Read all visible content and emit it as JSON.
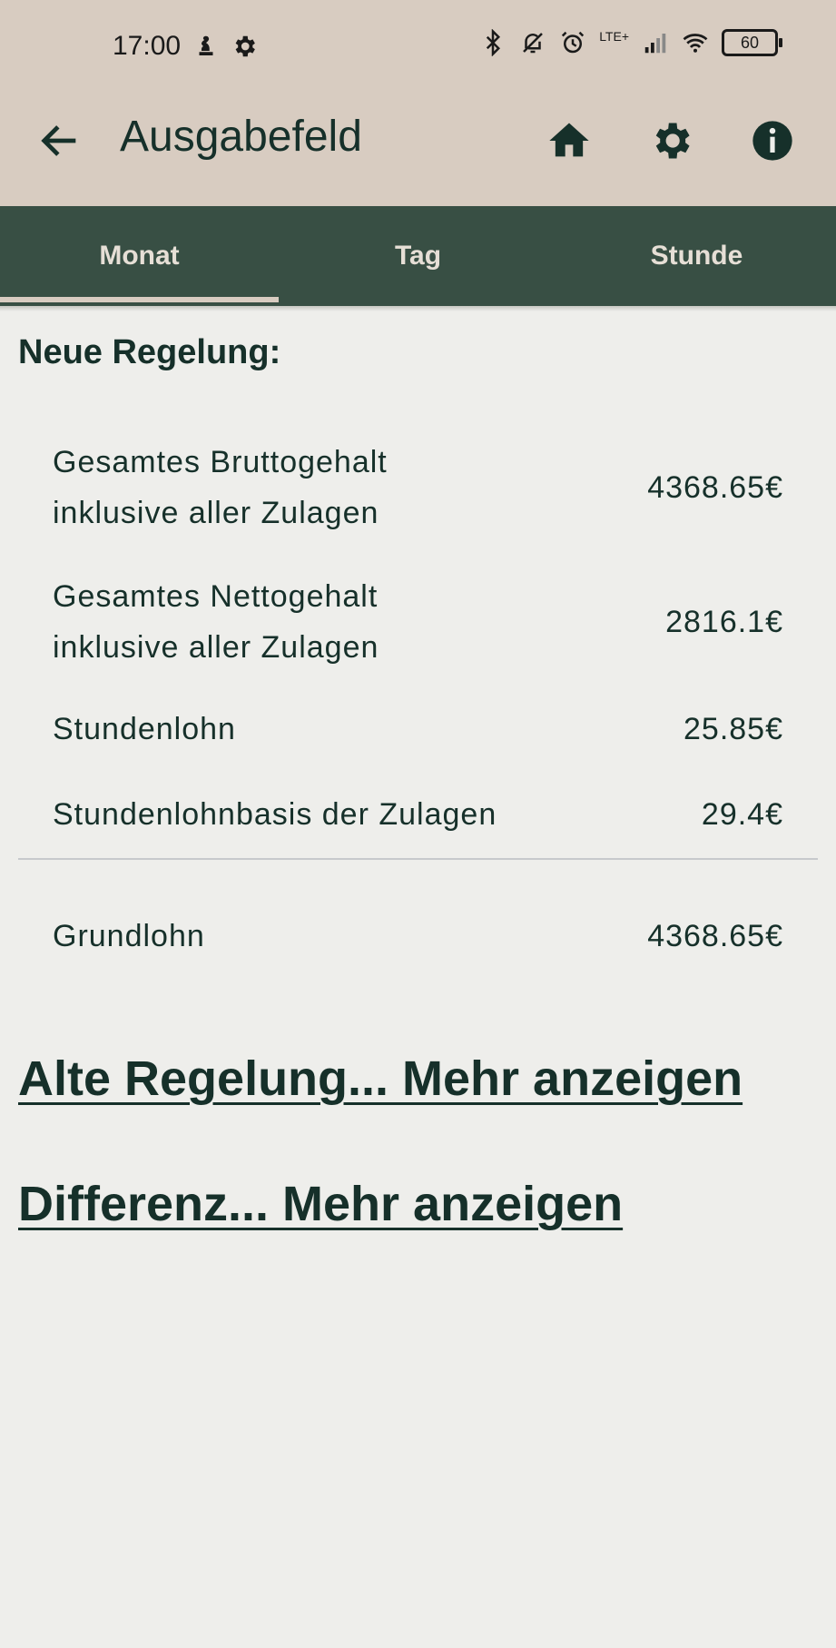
{
  "status": {
    "time": "17:00",
    "network": "LTE+",
    "battery": "60"
  },
  "appbar": {
    "title": "Ausgabefeld",
    "icons": [
      "arrow-back-icon",
      "home-icon",
      "gear-icon",
      "info-icon"
    ]
  },
  "tabs": [
    {
      "label": "Monat",
      "active": true
    },
    {
      "label": "Tag",
      "active": false
    },
    {
      "label": "Stunde",
      "active": false
    }
  ],
  "neue": {
    "heading": "Neue Regelung:",
    "rows": [
      {
        "label_line1": "Gesamtes Bruttogehalt",
        "label_line2": "inklusive aller Zulagen",
        "value": "4368.65€"
      },
      {
        "label_line1": "Gesamtes Nettogehalt",
        "label_line2": "inklusive aller Zulagen",
        "value": "2816.1€"
      },
      {
        "label_line1": "Stundenlohn",
        "value": "25.85€"
      },
      {
        "label_line1": "Stundenlohnbasis der Zulagen",
        "value": "29.4€"
      },
      {
        "label_line1": "Grundlohn",
        "value": "4368.65€"
      }
    ]
  },
  "links": {
    "alte": "Alte Regelung... Mehr anzeigen",
    "differenz": "Differenz... Mehr anzeigen"
  },
  "colors": {
    "appbar": "#d8ccc1",
    "tabs": "#384f44",
    "background": "#eeeeeb",
    "text": "#16302a"
  }
}
